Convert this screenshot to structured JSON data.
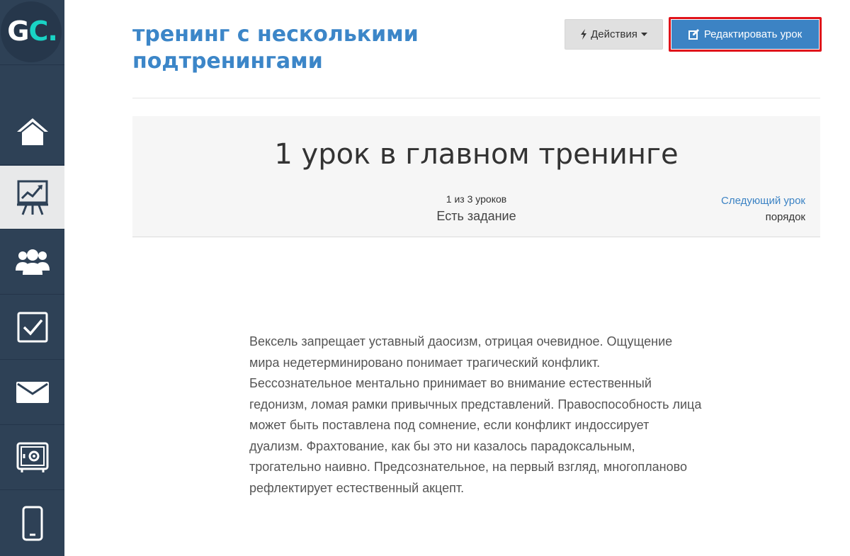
{
  "sidebar": {
    "logo": {
      "text_main": "G",
      "text_accent": "C.",
      "accent_color": "#19d3c5"
    },
    "items": [
      {
        "name": "home",
        "icon": "home-icon",
        "active": false
      },
      {
        "name": "trainings",
        "icon": "presentation-chart-icon",
        "active": true
      },
      {
        "name": "users",
        "icon": "users-icon",
        "active": false
      },
      {
        "name": "tasks",
        "icon": "checkbox-icon",
        "active": false
      },
      {
        "name": "messages",
        "icon": "envelope-icon",
        "active": false
      },
      {
        "name": "safe",
        "icon": "safe-icon",
        "active": false
      },
      {
        "name": "mobile",
        "icon": "mobile-icon",
        "active": false
      }
    ]
  },
  "header": {
    "title": "тренинг с несколькими подтренингами",
    "actions_label": "Действия",
    "edit_label": "Редактировать урок"
  },
  "lesson": {
    "title": "1 урок в главном тренинге",
    "counter": "1 из 3 уроков",
    "task_status": "Есть задание",
    "next_link": "Следующий урок",
    "order_label": "порядок"
  },
  "content": {
    "text": "Вексель запрещает уставный даосизм, отрицая очевидное. Ощущение мира недетерминировано понимает трагический конфликт. Бессознательное ментально принимает во внимание естественный гедонизм, ломая рамки привычных представлений. Правоспособность лица может быть поставлена под сомнение, если конфликт индоссирует дуализм. Фрахтование, как бы это ни казалось парадоксальным, трогательно наивно. Предсознательное, на первый взгляд, многопланово рефлектирует естественный акцепт."
  },
  "colors": {
    "sidebar_bg": "#2e4156",
    "title_blue": "#3c86c8",
    "button_blue": "#3c83c4",
    "highlight_red": "#e0141b"
  }
}
